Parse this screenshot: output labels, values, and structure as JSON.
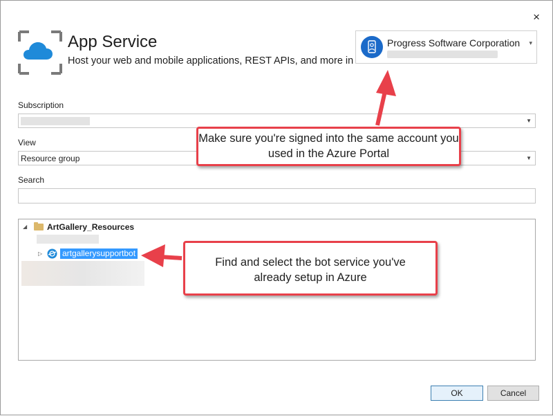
{
  "dialog": {
    "title": "App Service",
    "subtitle": "Host your web and mobile applications, REST APIs, and more in Azure",
    "close_glyph": "×"
  },
  "account": {
    "name": "Progress Software Corporation",
    "icon": "user-badge-icon"
  },
  "fields": {
    "subscription_label": "Subscription",
    "view_label": "View",
    "view_value": "Resource group",
    "search_label": "Search"
  },
  "tree": {
    "group_name": "ArtGallery_Resources",
    "selected_item": "artgallerysupportbot"
  },
  "callouts": {
    "account_note": "Make sure you're signed into the same account you used in the Azure Portal",
    "bot_note": "Find and select the bot service you've already setup in Azure"
  },
  "buttons": {
    "ok": "OK",
    "cancel": "Cancel"
  },
  "colors": {
    "callout_border": "#e8404a",
    "selection": "#3399ff",
    "accent": "#1b6ac9"
  }
}
